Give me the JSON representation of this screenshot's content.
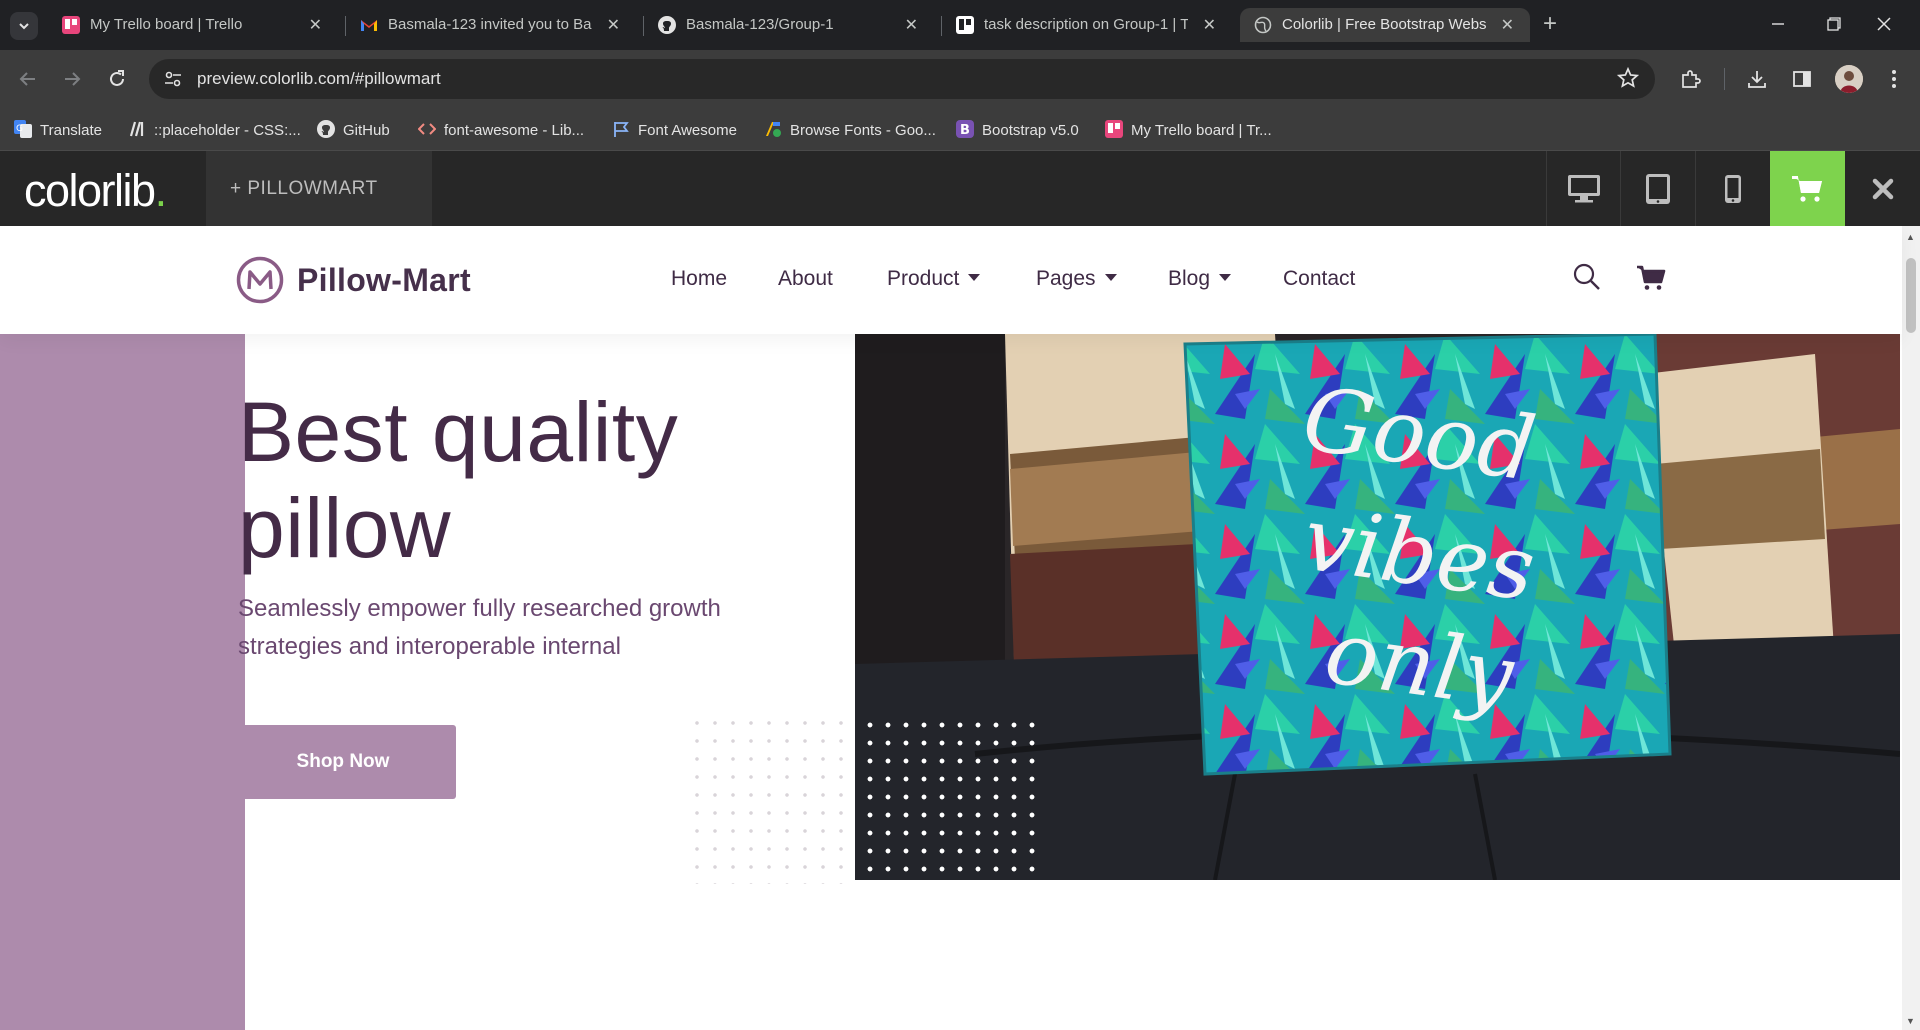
{
  "browser": {
    "tabs": [
      {
        "title": "My Trello board | Trello",
        "active": false
      },
      {
        "title": "Basmala-123 invited you to Bas",
        "active": false
      },
      {
        "title": "Basmala-123/Group-1",
        "active": false
      },
      {
        "title": "task description on Group-1 | Tr",
        "active": false
      },
      {
        "title": "Colorlib | Free Bootstrap Websit",
        "active": true
      }
    ],
    "url": "preview.colorlib.com/#pillowmart",
    "bookmarks": [
      {
        "label": "Translate",
        "icon": "google-translate-icon"
      },
      {
        "label": "::placeholder - CSS:...",
        "icon": "mdn-icon"
      },
      {
        "label": "GitHub",
        "icon": "github-icon"
      },
      {
        "label": "font-awesome - Lib...",
        "icon": "code-icon"
      },
      {
        "label": "Font Awesome",
        "icon": "flag-icon"
      },
      {
        "label": "Browse Fonts - Goo...",
        "icon": "google-fonts-icon"
      },
      {
        "label": "Bootstrap v5.0",
        "icon": "bootstrap-icon"
      },
      {
        "label": "My Trello board | Tr...",
        "icon": "trello-icon"
      }
    ]
  },
  "colorlib": {
    "logo": "colorlib",
    "logo_dot": ".",
    "project": "+  PILLOWMART",
    "accent": "#7ed34d"
  },
  "site": {
    "brand": "Pillow-Mart",
    "nav": [
      {
        "label": "Home",
        "dropdown": false
      },
      {
        "label": "About",
        "dropdown": false
      },
      {
        "label": "Product",
        "dropdown": true
      },
      {
        "label": "Pages",
        "dropdown": true
      },
      {
        "label": "Blog",
        "dropdown": true
      },
      {
        "label": "Contact",
        "dropdown": false
      }
    ],
    "hero": {
      "title_line1": "Best quality",
      "title_line2": "pillow",
      "subtitle": "Seamlessly empower fully researched growth strategies and interoperable internal",
      "cta": "Shop Now",
      "pillow_text": "Good vibes only"
    },
    "colors": {
      "primary": "#ad8bac",
      "heading": "#442b47"
    }
  }
}
